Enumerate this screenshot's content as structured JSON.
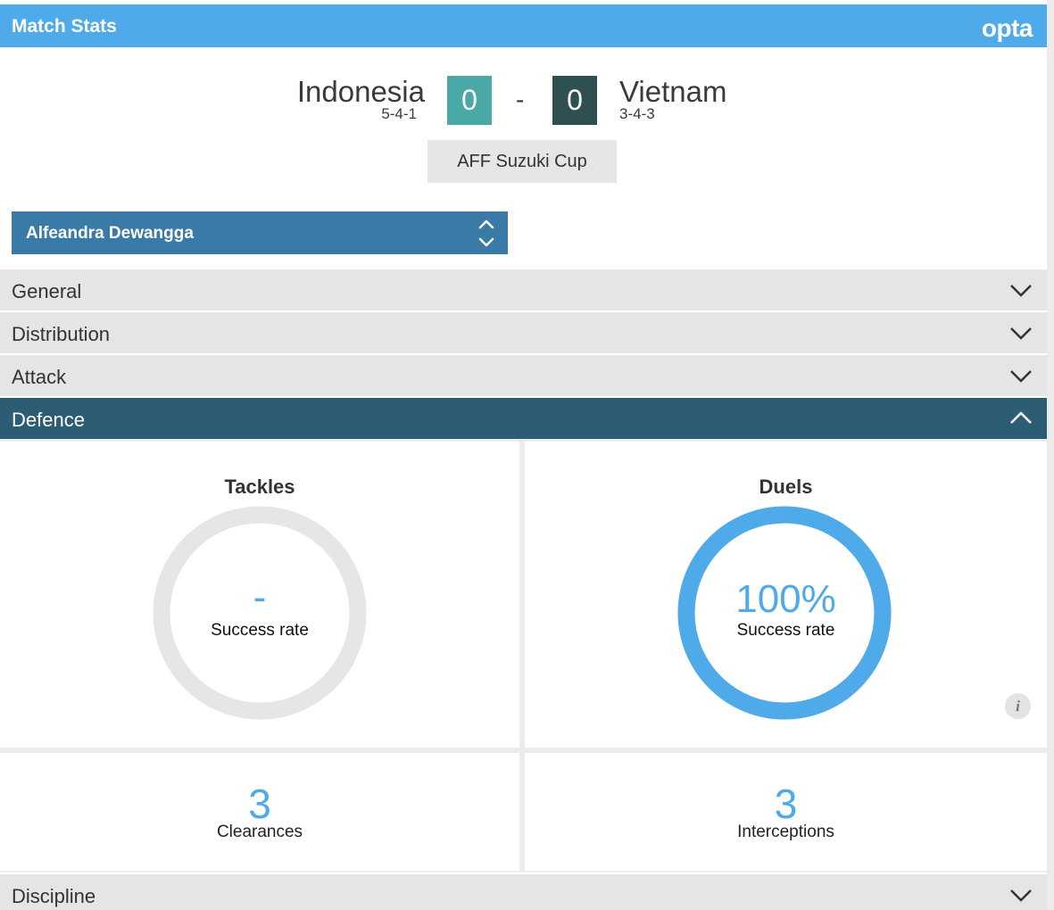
{
  "header": {
    "title": "Match Stats",
    "brand": "opta"
  },
  "match": {
    "home": {
      "team": "Indonesia",
      "formation": "5-4-1",
      "score": "0",
      "color": "#4aa8a6"
    },
    "away": {
      "team": "Vietnam",
      "formation": "3-4-3",
      "score": "0",
      "color": "#2e5050"
    },
    "separator": "-",
    "competition": "AFF Suzuki Cup"
  },
  "player_select": {
    "selected": "Alfeandra Dewangga"
  },
  "sections": [
    {
      "label": "General",
      "expanded": false
    },
    {
      "label": "Distribution",
      "expanded": false
    },
    {
      "label": "Attack",
      "expanded": false
    },
    {
      "label": "Defence",
      "expanded": true
    },
    {
      "label": "Discipline",
      "expanded": false
    }
  ],
  "defence": {
    "tackles": {
      "title": "Tackles",
      "value": "-",
      "label": "Success rate",
      "fraction": 0
    },
    "duels": {
      "title": "Duels",
      "value": "100%",
      "label": "Success rate",
      "fraction": 1.0
    },
    "clearances": {
      "value": "3",
      "label": "Clearances"
    },
    "interceptions": {
      "value": "3",
      "label": "Interceptions"
    },
    "info_icon": "i"
  },
  "colors": {
    "header_bg": "#4eaae8",
    "accent": "#4eaae8",
    "player_select_bg": "#3a7aa6",
    "active_section_bg": "#2d5d75",
    "section_bg": "#e5e5e5",
    "ring_empty": "#e6e6e6"
  },
  "icons": {
    "select_arrows": "chevron-up-down-icon",
    "section_collapsed": "chevron-down-icon",
    "section_expanded": "chevron-up-icon",
    "info": "info-icon"
  }
}
